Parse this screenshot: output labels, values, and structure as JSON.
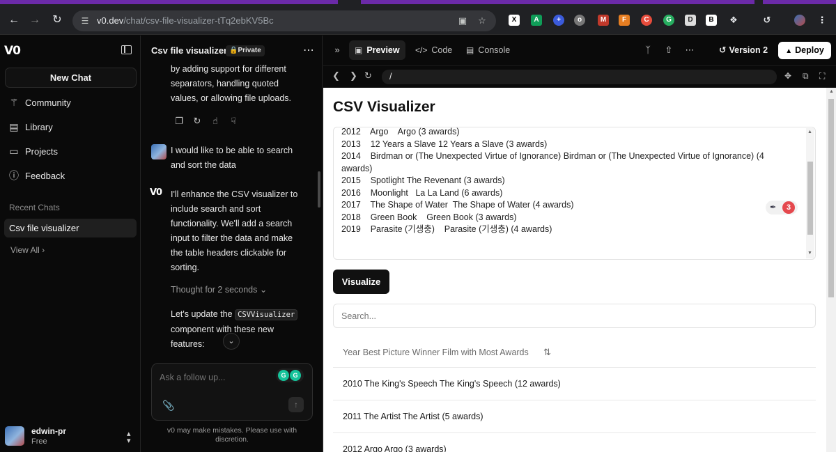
{
  "browser": {
    "url_host": "v0.dev",
    "url_path": "/chat/csv-file-visualizer-tTq2ebKV5Bc"
  },
  "sidebar": {
    "new_chat": "New Chat",
    "nav": [
      {
        "label": "Community",
        "icon": "community-icon"
      },
      {
        "label": "Library",
        "icon": "library-icon"
      },
      {
        "label": "Projects",
        "icon": "folder-icon"
      },
      {
        "label": "Feedback",
        "icon": "help-icon"
      }
    ],
    "recent_label": "Recent Chats",
    "recent_item": "Csv file visualizer",
    "view_all": "View All",
    "user": {
      "name": "edwin-pr",
      "plan": "Free"
    }
  },
  "chat": {
    "title": "Csv file visualizer",
    "badge": "Private",
    "msg1_lines": [
      "by adding support for different",
      "separators, handling quoted",
      "values, or allowing file uploads."
    ],
    "user_msg_lines": [
      "I would like to be able to search",
      "and sort the data"
    ],
    "reply_lines": [
      "I'll enhance the CSV visualizer to",
      "include search and sort",
      "functionality. We'll add a search",
      "input to filter the data and make",
      "the table headers clickable for",
      "sorting."
    ],
    "thought": "Thought for 2 seconds",
    "update_pre": "Let's update the",
    "update_code": "CSVVisualizer",
    "update_line2": "component with these new",
    "update_line3": "features:",
    "composer_placeholder": "Ask a follow up...",
    "disclaimer": "v0 may make mistakes. Please use with discretion."
  },
  "preview_bar": {
    "tabs": [
      {
        "label": "Preview",
        "active": true
      },
      {
        "label": "Code",
        "active": false
      },
      {
        "label": "Console",
        "active": false
      }
    ],
    "version": "Version 2",
    "deploy": "Deploy",
    "address": "/"
  },
  "app": {
    "title": "CSV Visualizer",
    "csv_lines": [
      "2012    Argo    Argo (3 awards)",
      "2013    12 Years a Slave 12 Years a Slave (3 awards)",
      "2014    Birdman or (The Unexpected Virtue of Ignorance) Birdman or (The Unexpected Virtue of Ignorance) (4",
      "awards)",
      "2015    Spotlight The Revenant (3 awards)",
      "2016    Moonlight   La La Land (6 awards)",
      "2017    The Shape of Water  The Shape of Water (4 awards)",
      "2018    Green Book    Green Book (3 awards)",
      "2019    Parasite (기생충)    Parasite (기생충) (4 awards)"
    ],
    "ext_count": "3",
    "visualize": "Visualize",
    "search_placeholder": "Search...",
    "table_header": "Year Best Picture Winner Film with Most Awards",
    "rows": [
      "2010 The King's Speech The King's Speech (12 awards)",
      "2011 The Artist The Artist (5 awards)",
      "2012 Argo Argo (3 awards)"
    ]
  }
}
